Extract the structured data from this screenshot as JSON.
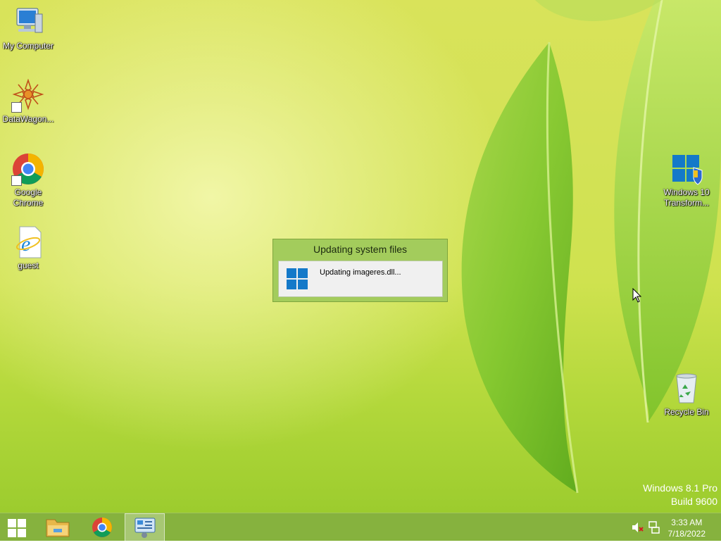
{
  "desktop": {
    "icons": [
      {
        "label": "My Computer"
      },
      {
        "label": "DataWagon..."
      },
      {
        "label": "Google Chrome"
      },
      {
        "label": "guest"
      },
      {
        "label": "Windows 10 Transform..."
      },
      {
        "label": "Recycle Bin"
      }
    ],
    "watermark": {
      "edition": "Windows 8.1 Pro",
      "build": "Build 9600"
    }
  },
  "dialog": {
    "title": "Updating system files",
    "message": "Updating imageres.dll..."
  },
  "taskbar": {
    "buttons": [
      {
        "icon": "start-icon"
      },
      {
        "icon": "file-explorer-icon"
      },
      {
        "icon": "chrome-icon"
      },
      {
        "icon": "control-panel-icon",
        "active": true
      }
    ],
    "tray": {
      "volume_icon": "volume-muted-icon",
      "network_icon": "network-icon",
      "time": "3:33 AM",
      "date": "7/18/2022"
    }
  },
  "colors": {
    "taskbar": "#86b23e",
    "dialog_frame": "#a3cc5c",
    "windows_blue": "#1479c9"
  }
}
